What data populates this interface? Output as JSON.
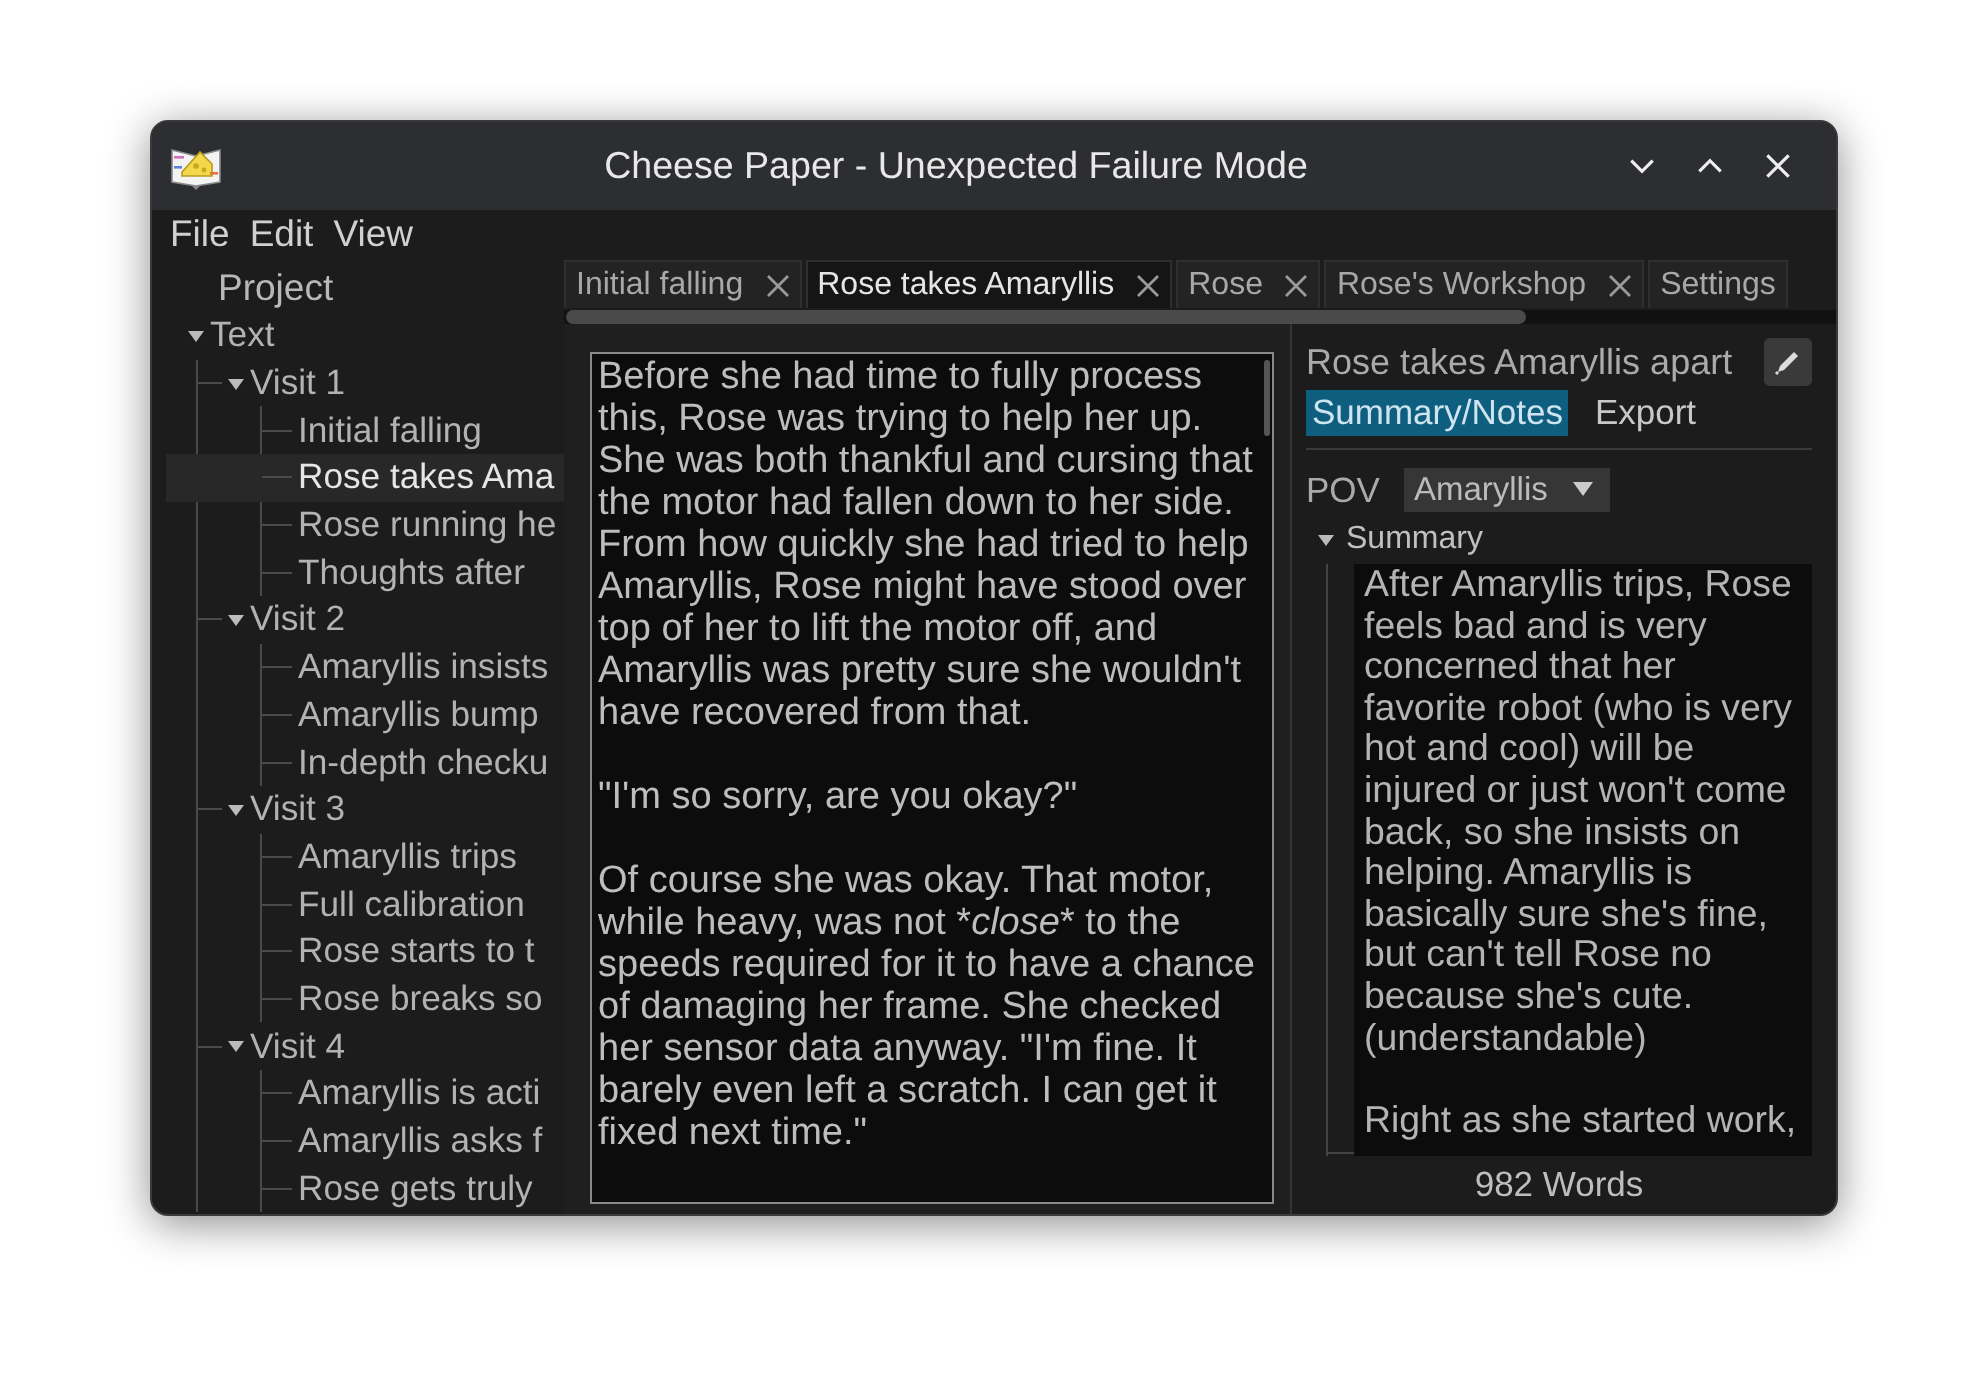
{
  "window": {
    "title": "Cheese Paper - Unexpected Failure Mode"
  },
  "menu": [
    "File",
    "Edit",
    "View"
  ],
  "sidebar": {
    "heading": "Project",
    "items": [
      {
        "label": "Text",
        "expanded": true,
        "selected": false,
        "children": [
          {
            "label": "Visit 1",
            "expanded": true,
            "selected": false,
            "children": [
              {
                "label": "Initial falling",
                "selected": false
              },
              {
                "label": "Rose takes Ama",
                "selected": true
              },
              {
                "label": "Rose running he",
                "selected": false
              },
              {
                "label": "Thoughts after",
                "selected": false
              }
            ]
          },
          {
            "label": "Visit 2",
            "expanded": true,
            "selected": false,
            "children": [
              {
                "label": "Amaryllis insists",
                "selected": false
              },
              {
                "label": "Amaryllis bump",
                "selected": false
              },
              {
                "label": "In-depth checku",
                "selected": false
              }
            ]
          },
          {
            "label": "Visit 3",
            "expanded": true,
            "selected": false,
            "children": [
              {
                "label": "Amaryllis trips",
                "selected": false
              },
              {
                "label": "Full calibration",
                "selected": false
              },
              {
                "label": "Rose starts to t",
                "selected": false
              },
              {
                "label": "Rose breaks so",
                "selected": false
              }
            ]
          },
          {
            "label": "Visit 4",
            "expanded": true,
            "selected": false,
            "children": [
              {
                "label": "Amaryllis is acti",
                "selected": false
              },
              {
                "label": "Amaryllis asks f",
                "selected": false
              },
              {
                "label": "Rose gets truly",
                "selected": false
              }
            ]
          }
        ]
      }
    ]
  },
  "tabs": [
    {
      "label": "Initial falling",
      "selected": false
    },
    {
      "label": "Rose takes Amaryllis",
      "selected": true
    },
    {
      "label": "Rose",
      "selected": false
    },
    {
      "label": "Rose's Workshop",
      "selected": false
    },
    {
      "label": "Settings",
      "selected": false
    }
  ],
  "editor": {
    "paragraphs": [
      [
        {
          "text": "Before she had time to fully process this, Rose was trying to help her up. She was both thankful and cursing that the motor had fallen down to her side. From how quickly she had tried to help Amaryllis, Rose might have stood over top of her to lift the motor off, and Amaryllis was pretty sure she wouldn't have recovered from that."
        }
      ],
      [
        {
          "text": "\"I'm so sorry, are you okay?\""
        }
      ],
      [
        {
          "text": "Of course she was okay. That motor, while heavy, was not *"
        },
        {
          "text": "close",
          "italic": true
        },
        {
          "text": "* to the speeds required for it to have a chance of damaging her frame. She checked her sensor data anyway. \"I'm fine. It barely even left a scratch. I can get it fixed next time.\""
        }
      ]
    ]
  },
  "panel": {
    "title": "Rose takes Amaryllis apart",
    "tabs": [
      {
        "label": "Summary/Notes",
        "selected": true
      },
      {
        "label": "Export",
        "selected": false
      }
    ],
    "pov": {
      "label": "POV",
      "value": "Amaryllis"
    },
    "summary": {
      "label": "Summary",
      "expanded": true,
      "paragraphs": [
        "After Amaryllis trips, Rose feels bad and is very concerned that her favorite robot (who is very hot and cool) will be injured or just won't come back, so she insists on helping. Amaryllis is basically sure she's fine, but can't tell Rose no because she's cute. (understandable)",
        "Right as she started work,"
      ]
    },
    "word_count": "982 Words"
  }
}
